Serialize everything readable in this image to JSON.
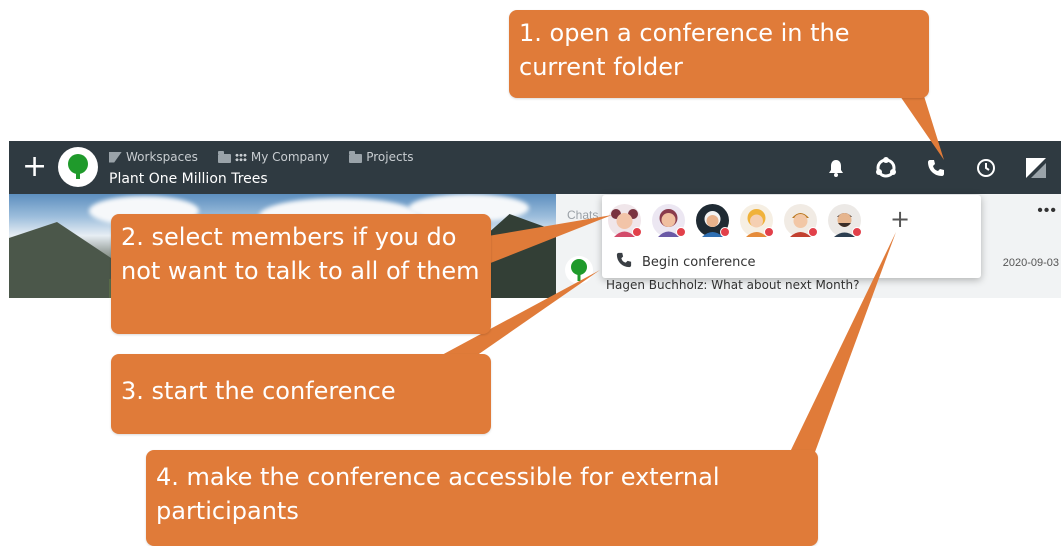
{
  "appbar": {
    "add_label": "+",
    "breadcrumbs": [
      {
        "label": "Workspaces",
        "icon": "workspaces-icon"
      },
      {
        "label": "My Company",
        "icon": "apps-grid-icon"
      },
      {
        "label": "Projects",
        "icon": "folder-icon"
      }
    ],
    "title": "Plant One Million Trees",
    "right_icons": [
      "bell-icon",
      "community-icon",
      "phone-icon",
      "clock-icon",
      "workspaces-logo-icon"
    ]
  },
  "chat": {
    "label": "Chats",
    "more": "•••",
    "date": "2020-09-03",
    "preview": "Hagen Buchholz: What about next Month?"
  },
  "popup": {
    "members": [
      {
        "name": "member-avatar-1",
        "status": "offline"
      },
      {
        "name": "member-avatar-2",
        "status": "offline"
      },
      {
        "name": "member-avatar-3",
        "status": "offline"
      },
      {
        "name": "member-avatar-4",
        "status": "offline"
      },
      {
        "name": "member-avatar-5",
        "status": "offline"
      },
      {
        "name": "member-avatar-6",
        "status": "offline"
      }
    ],
    "add_label": "+",
    "begin_label": "Begin conference"
  },
  "callouts": {
    "c1": "1. open a conference in the current folder",
    "c2": "2. select members if you do not want to talk to all of them",
    "c3": "3. start the conference",
    "c4": "4. make the conference accessible for external participants"
  },
  "colors": {
    "appbar": "#2f3a41",
    "callout": "#e07b39",
    "status_offline": "#e2404a",
    "tree_green": "#1f9a2b"
  }
}
